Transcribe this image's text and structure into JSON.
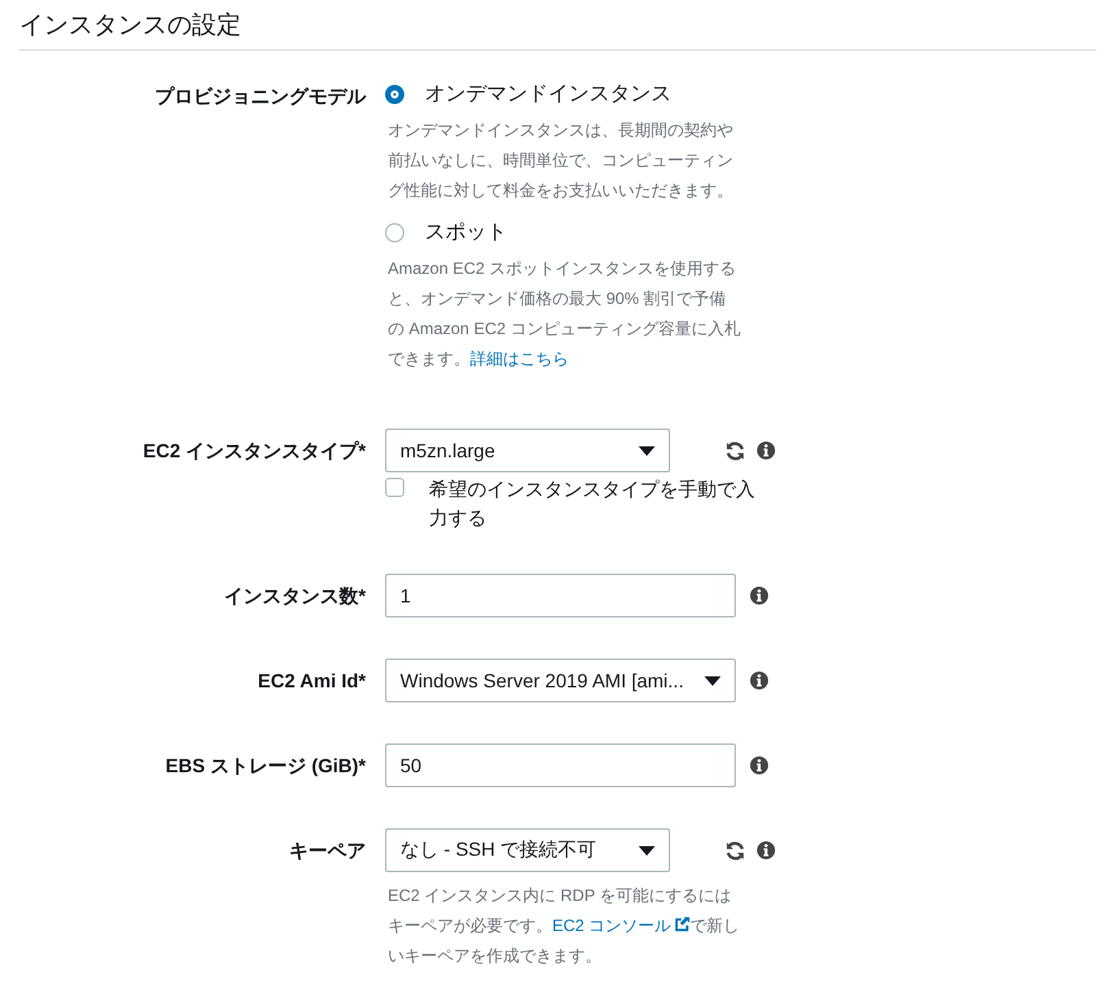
{
  "section": {
    "title": "インスタンスの設定"
  },
  "fields": [
    {
      "kind": "radio_group",
      "label": "プロビジョニングモデル",
      "options": [
        {
          "label": "オンデマンドインスタンス",
          "selected": true,
          "hint": [
            {
              "kind": "text",
              "text": "オンデマンドインスタンスは、長期間の契約や前払いなしに、時間単位で、コンピューティング性能に対して料金をお支払いいただきます。"
            }
          ]
        },
        {
          "label": "スポット",
          "selected": false,
          "hint": [
            {
              "kind": "text",
              "text": "Amazon EC2 スポットインスタンスを使用すると、オンデマンド価格の最大 90% 割引で予備の Amazon EC2 コンピューティング容量に入札できます。"
            },
            {
              "kind": "link",
              "text": "詳細はこちら"
            }
          ]
        }
      ]
    },
    {
      "kind": "select",
      "label": "EC2 インスタンスタイプ*",
      "value": "m5zn.large",
      "refresh": true,
      "info": true,
      "checkbox": {
        "label": "希望のインスタンスタイプを手動で入力する",
        "checked": false
      }
    },
    {
      "kind": "input",
      "label": "インスタンス数*",
      "value": "1",
      "info": true
    },
    {
      "kind": "select",
      "label": "EC2 Ami Id*",
      "value": "Windows Server 2019 AMI [ami...",
      "info": true
    },
    {
      "kind": "input",
      "label": "EBS ストレージ (GiB)*",
      "value": "50",
      "info": true
    },
    {
      "kind": "select",
      "label": "キーペア",
      "value": "なし - SSH で接続不可",
      "refresh": true,
      "info": true,
      "hint": [
        {
          "kind": "text",
          "text": "EC2 インスタンス内に RDP を可能にするにはキーペアが必要です。"
        },
        {
          "kind": "external_link",
          "text": "EC2 コンソール"
        },
        {
          "kind": "text",
          "text": "で新しいキーペアを作成できます。"
        }
      ]
    }
  ]
}
